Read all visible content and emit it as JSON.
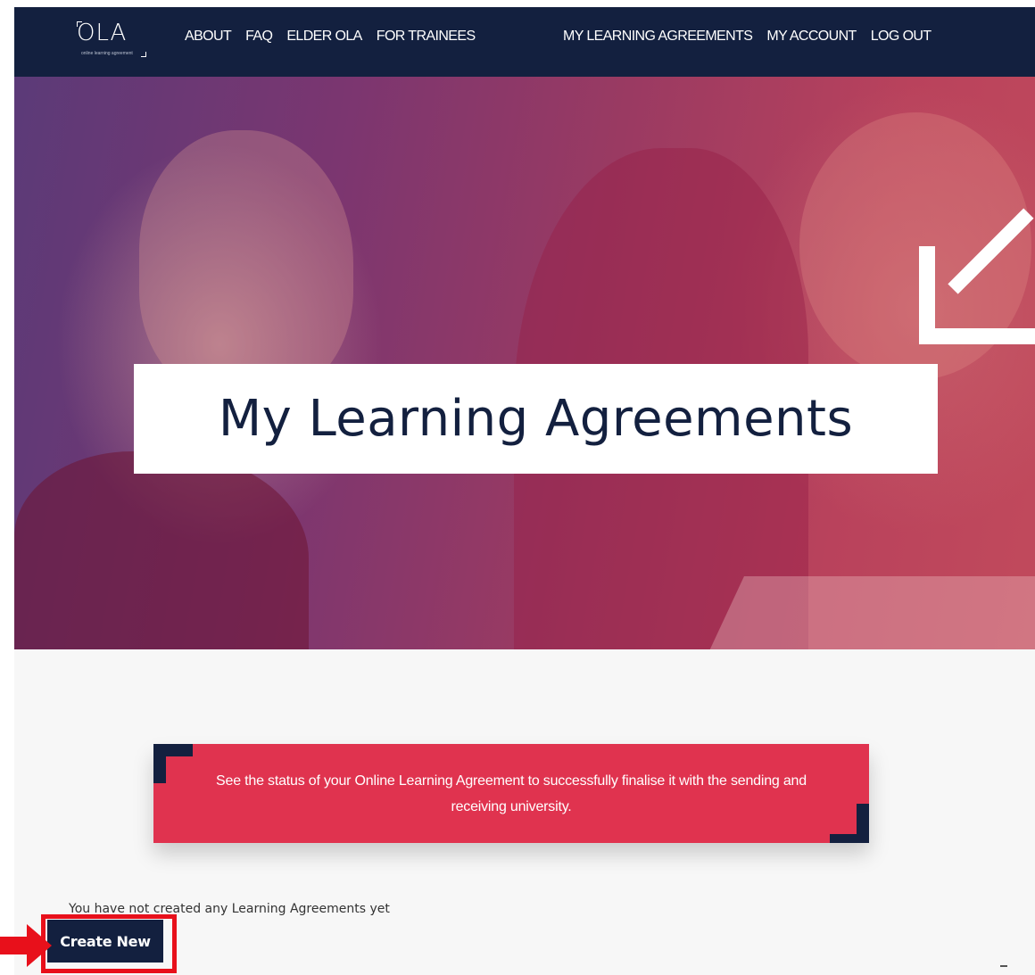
{
  "header": {
    "logo_text": "OLA",
    "logo_tagline": "online learning agreement",
    "nav_left": [
      "ABOUT",
      "FAQ",
      "ELDER OLA",
      "FOR TRAINEES"
    ],
    "nav_right": [
      "MY LEARNING AGREEMENTS",
      "MY ACCOUNT",
      "LOG OUT"
    ]
  },
  "hero": {
    "title": "My Learning Agreements"
  },
  "banner": {
    "text": "See the status of your Online Learning Agreement to successfully finalise it with the sending and receiving university."
  },
  "main": {
    "empty_message": "You have not created any Learning Agreements yet",
    "create_button": "Create New"
  },
  "colors": {
    "navy": "#13203f",
    "banner_red": "#e0334f",
    "highlight_red": "#e8101b"
  }
}
